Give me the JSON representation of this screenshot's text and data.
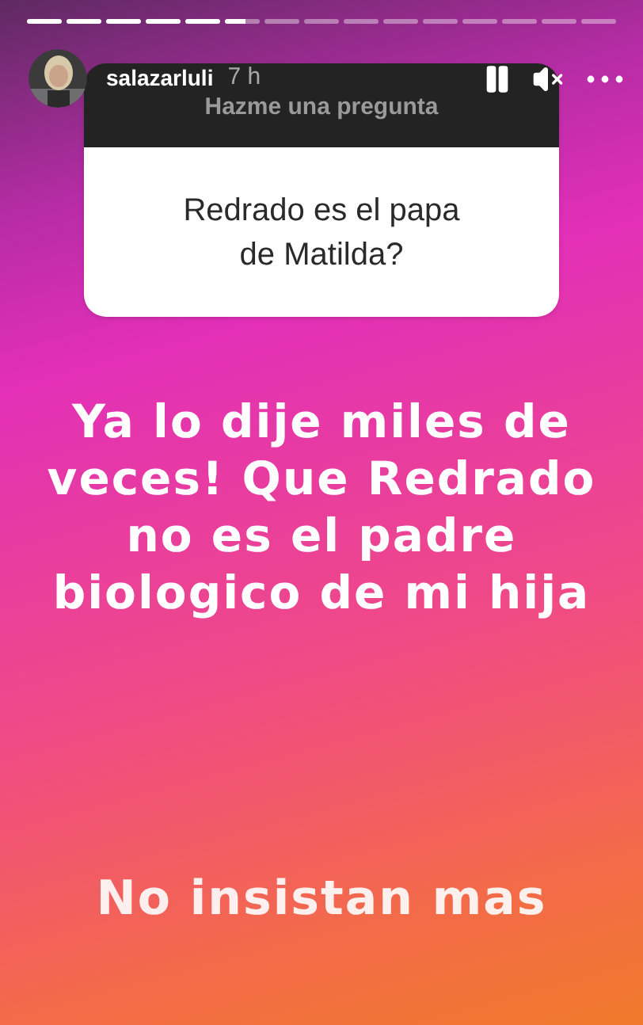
{
  "progress": [
    {
      "kind": "viewed"
    },
    {
      "kind": "viewed"
    },
    {
      "kind": "viewed"
    },
    {
      "kind": "viewed"
    },
    {
      "kind": "viewed"
    },
    {
      "kind": "playing"
    },
    {
      "kind": "unseen"
    },
    {
      "kind": "unseen"
    },
    {
      "kind": "unseen"
    },
    {
      "kind": "unseen"
    },
    {
      "kind": "unseen"
    },
    {
      "kind": "unseen"
    },
    {
      "kind": "unseen"
    },
    {
      "kind": "unseen"
    },
    {
      "kind": "unseen"
    }
  ],
  "header": {
    "username": "salazarluli",
    "time": "7 h",
    "muted": true
  },
  "question_sticker": {
    "title": "Hazme una pregunta",
    "question": "Redrado es el papa de Matilda?"
  },
  "story_texts": [
    "Ya lo dije miles de veces! Que Redrado no es el padre biologico de mi hija",
    "No insistan mas"
  ]
}
